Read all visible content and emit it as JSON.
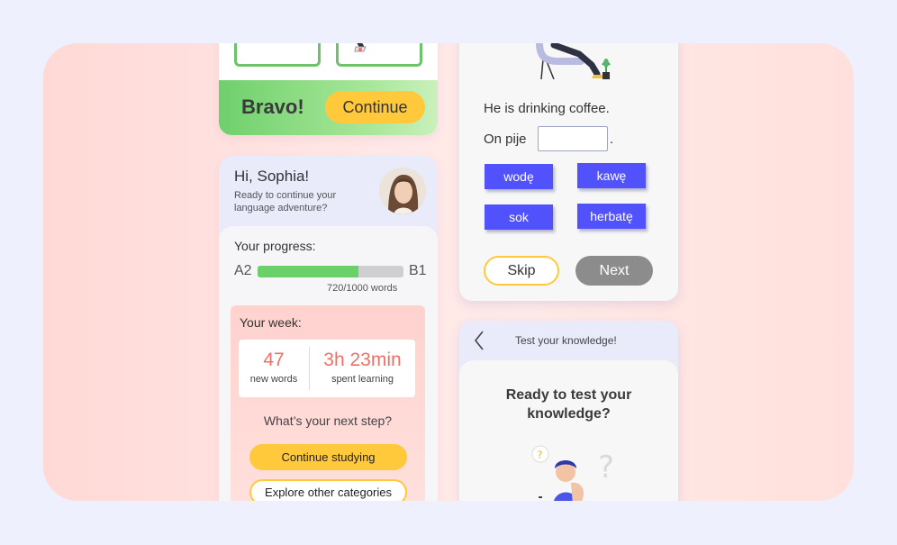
{
  "feedback": {
    "bravo": "Bravo!",
    "continue": "Continue"
  },
  "profile": {
    "greeting": "Hi, Sophia!",
    "subtitle": "Ready to continue your language adventure?",
    "progress_title": "Your progress:",
    "level_from": "A2",
    "level_to": "B1",
    "progress_fraction": 0.69,
    "words_count": "720/1000 words",
    "week": {
      "title": "Your week:",
      "new_words_value": "47",
      "new_words_label": "new words",
      "time_value": "3h 23min",
      "time_label": "spent learning"
    },
    "next_step": "What’s your next step?",
    "continue_studying": "Continue studying",
    "explore": "Explore other categories"
  },
  "quiz": {
    "sentence": "He is drinking coffee.",
    "prompt": "On pije",
    "prompt_end": ".",
    "options": [
      "wodę",
      "kawę",
      "sok",
      "herbatę"
    ],
    "skip": "Skip",
    "next": "Next"
  },
  "test": {
    "header": "Test your knowledge!",
    "title": "Ready to test your knowledge?"
  },
  "colors": {
    "accent_yellow": "#ffc93b",
    "success_green": "#6cd06a",
    "chip_blue": "#5152fb",
    "stat_coral": "#f07065"
  }
}
